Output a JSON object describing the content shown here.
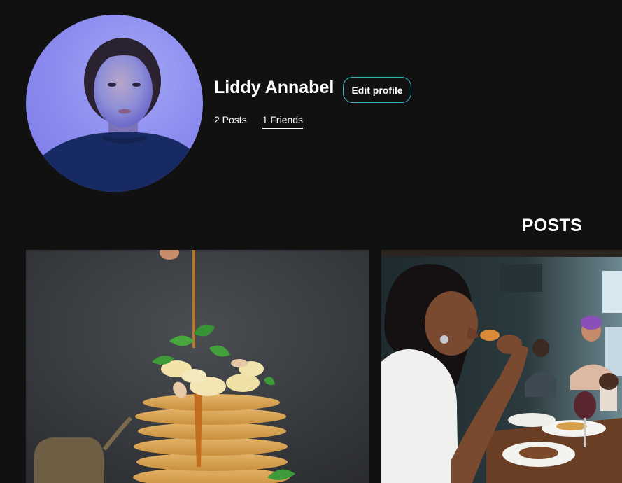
{
  "profile": {
    "name": "Liddy Annabel",
    "edit_label": "Edit profile",
    "posts_count": "2 Posts",
    "friends_count": "1 Friends"
  },
  "posts_section": {
    "title": "POSTS",
    "items": [
      {
        "subject": "pancake stack with syrup and banana"
      },
      {
        "subject": "woman eating at restaurant"
      }
    ]
  },
  "colors": {
    "background": "#111111",
    "accent_border": "#3fb3c6",
    "text": "#ffffff"
  }
}
